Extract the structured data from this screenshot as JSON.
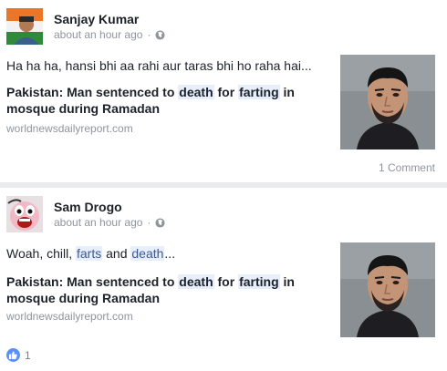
{
  "posts": [
    {
      "author": "Sanjay Kumar",
      "timestamp": "about an hour ago",
      "separator": "·",
      "privacy_icon": "globe-icon",
      "status_text": "Ha ha ha, hansi bhi aa rahi aur taras bhi ho raha hai...",
      "link": {
        "title_parts": [
          "Pakistan: Man sentenced to ",
          "death",
          " for ",
          "farting",
          " in mosque during Ramadan"
        ],
        "domain": "worldnewsdailyreport.com"
      },
      "comments": "1 Comment"
    },
    {
      "author": "Sam Drogo",
      "timestamp": "about an hour ago",
      "separator": "·",
      "privacy_icon": "globe-icon",
      "status_parts": [
        "Woah, chill, ",
        "farts",
        " and ",
        "death",
        "..."
      ],
      "link": {
        "title_parts": [
          "Pakistan: Man sentenced to ",
          "death",
          " for ",
          "farting",
          " in mosque during Ramadan"
        ],
        "domain": "worldnewsdailyreport.com"
      },
      "reactions": {
        "icon": "like-icon",
        "count": "1"
      }
    }
  ],
  "colors": {
    "brand_link": "#3b5998",
    "highlight_bg": "#e7eefc",
    "meta_gray": "#90949c",
    "separator": "#e9ebee",
    "like_blue": "#5890ff"
  }
}
